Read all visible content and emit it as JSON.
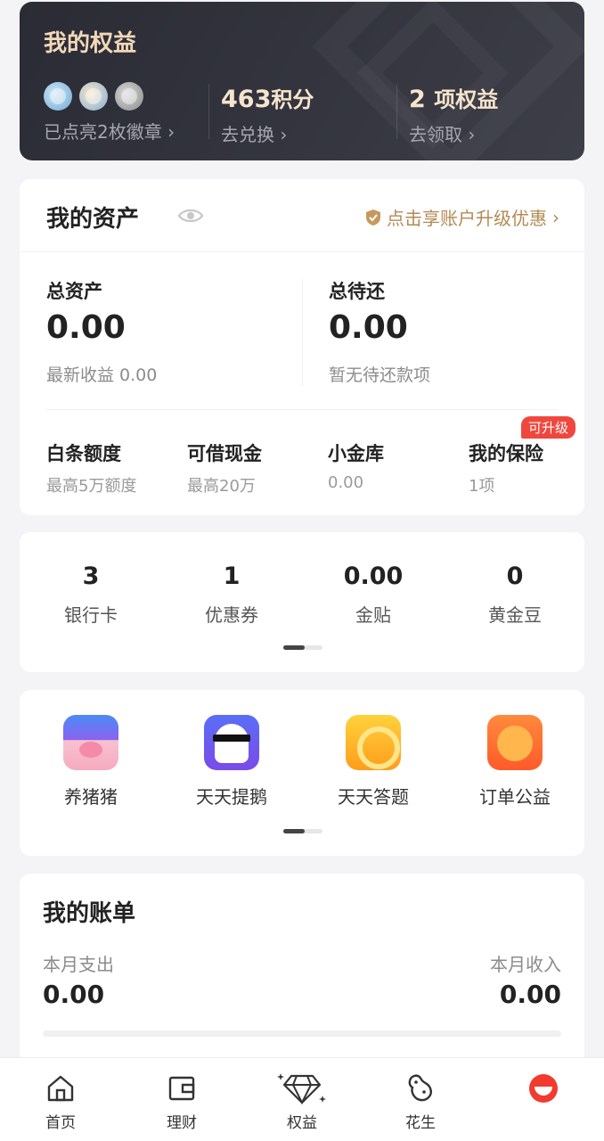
{
  "benefits": {
    "title": "我的权益",
    "badges_text": "已点亮2枚徽章",
    "points_value": "463",
    "points_unit": "积分",
    "points_action": "去兑换",
    "rights_value": "2",
    "rights_unit": "项权益",
    "rights_action": "去领取"
  },
  "assets": {
    "title": "我的资产",
    "upgrade_text": "点击享账户升级优惠",
    "total_label": "总资产",
    "total_value": "0.00",
    "total_hint": "最新收益 0.00",
    "repay_label": "总待还",
    "repay_value": "0.00",
    "repay_hint": "暂无待还款项",
    "tag": "可升级",
    "quick": [
      {
        "label": "白条额度",
        "sub": "最高5万额度"
      },
      {
        "label": "可借现金",
        "sub": "最高20万"
      },
      {
        "label": "小金库",
        "sub": "0.00"
      },
      {
        "label": "我的保险",
        "sub": "1项"
      }
    ]
  },
  "stats": [
    {
      "value": "3",
      "label": "银行卡"
    },
    {
      "value": "1",
      "label": "优惠券"
    },
    {
      "value": "0.00",
      "label": "金贴"
    },
    {
      "value": "0",
      "label": "黄金豆"
    }
  ],
  "apps": [
    {
      "label": "养猪猪",
      "icon": "pig-icon"
    },
    {
      "label": "天天提鹅",
      "icon": "goose-icon"
    },
    {
      "label": "天天答题",
      "icon": "quiz-icon"
    },
    {
      "label": "订单公益",
      "icon": "dog-icon"
    }
  ],
  "bill": {
    "title": "我的账单",
    "expense_label": "本月支出",
    "expense_value": "0.00",
    "income_label": "本月收入",
    "income_value": "0.00"
  },
  "nav": [
    {
      "label": "首页",
      "icon": "home-icon"
    },
    {
      "label": "理财",
      "icon": "wallet-icon"
    },
    {
      "label": "权益",
      "icon": "diamond-icon"
    },
    {
      "label": "花生",
      "icon": "peanut-icon"
    },
    {
      "label": "",
      "icon": "profile-icon"
    }
  ],
  "colors": {
    "gold": "#b38a55",
    "red": "#f0473d",
    "dark_card": "#2f3039"
  }
}
